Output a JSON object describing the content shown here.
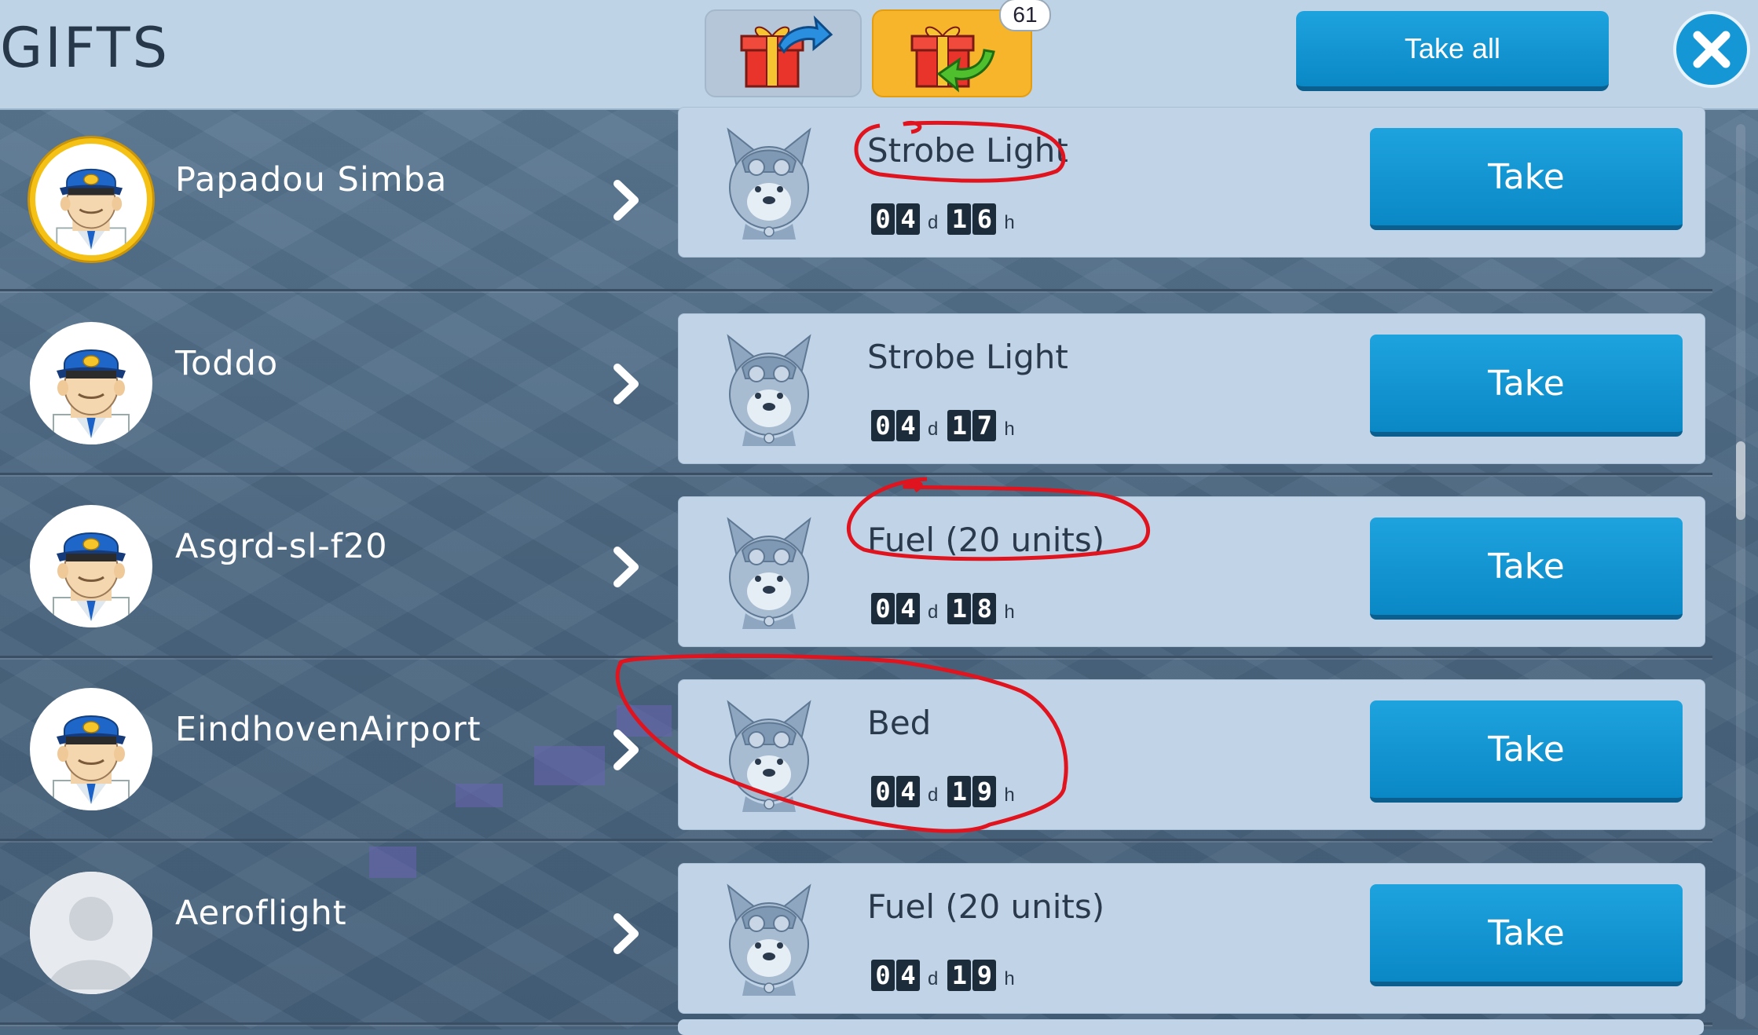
{
  "header": {
    "title": "GIFTS",
    "badge_count": "61",
    "take_all_label": "Take all",
    "tabs": [
      {
        "name": "send-gifts-tab",
        "icon": "gift-send-icon",
        "active": false
      },
      {
        "name": "received-gifts-tab",
        "icon": "gift-receive-icon",
        "active": true
      }
    ],
    "close_icon": "close-icon"
  },
  "gifts": [
    {
      "sender": "Papadou Simba",
      "avatar": "pilot",
      "vip": true,
      "item": "Strobe Light",
      "days": [
        "0",
        "4"
      ],
      "hours": [
        "1",
        "6"
      ],
      "take_label": "Take"
    },
    {
      "sender": "Toddo",
      "avatar": "pilot",
      "vip": false,
      "item": "Strobe Light",
      "days": [
        "0",
        "4"
      ],
      "hours": [
        "1",
        "7"
      ],
      "take_label": "Take"
    },
    {
      "sender": "Asgrd-sl-f20",
      "avatar": "pilot",
      "vip": false,
      "item": "Fuel (20 units)",
      "days": [
        "0",
        "4"
      ],
      "hours": [
        "1",
        "8"
      ],
      "take_label": "Take"
    },
    {
      "sender": "EindhovenAirport",
      "avatar": "pilot",
      "vip": false,
      "item": "Bed",
      "days": [
        "0",
        "4"
      ],
      "hours": [
        "1",
        "9"
      ],
      "take_label": "Take"
    },
    {
      "sender": "Aeroflight",
      "avatar": "silhouette",
      "vip": false,
      "item": "Fuel (20 units)",
      "days": [
        "0",
        "4"
      ],
      "hours": [
        "1",
        "9"
      ],
      "take_label": "Take"
    }
  ],
  "timer_units": {
    "days": "d",
    "hours": "h"
  },
  "colors": {
    "header_bg": "#bed3e6",
    "button_blue": "#0a88c6",
    "active_tab": "#f6b52a",
    "annotation_red": "#e0141e"
  }
}
